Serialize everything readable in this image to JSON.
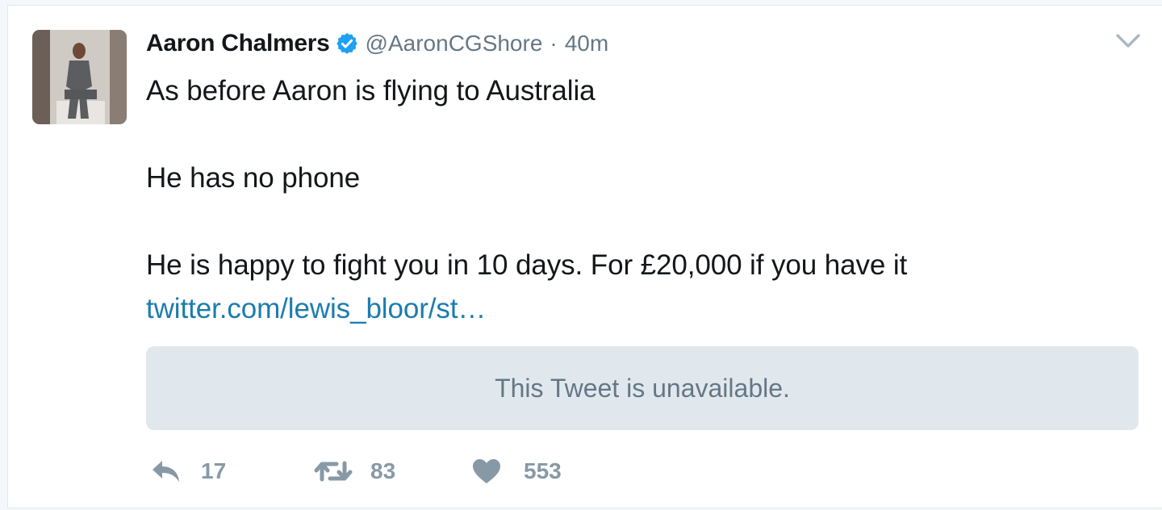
{
  "tweet": {
    "author_name": "Aaron Chalmers",
    "handle": "@AaronCGShore",
    "separator": "·",
    "timestamp": "40m",
    "text_lines": [
      "As before Aaron is flying to Australia",
      "",
      "He has no phone",
      "",
      "He is happy to fight you in 10 days. For £20,000 if you have it"
    ],
    "link": "twitter.com/lewis_bloor/st…",
    "quoted_card": "This Tweet is unavailable.",
    "actions": {
      "reply_count": "17",
      "retweet_count": "83",
      "like_count": "553"
    }
  },
  "icons": {
    "verified": "verified-badge-icon",
    "caret": "chevron-down-icon",
    "reply": "reply-icon",
    "retweet": "retweet-icon",
    "like": "heart-icon"
  },
  "colors": {
    "verified_blue": "#1da1f2",
    "link": "#1b7cae",
    "secondary_text": "#657786",
    "action_icon": "#8899a6",
    "card_bg": "#e1e8ed"
  }
}
